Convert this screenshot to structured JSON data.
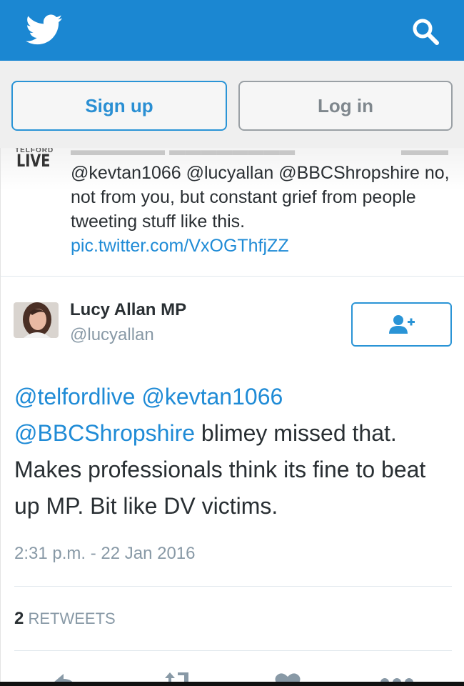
{
  "header": {
    "logo_icon": "twitter-bird-icon",
    "search_icon": "search-icon",
    "brand_color": "#1b87d2"
  },
  "auth": {
    "signup_label": "Sign up",
    "login_label": "Log in"
  },
  "previous_tweet": {
    "avatar_text": "LIVE",
    "text": "@kevtan1066 @lucyallan @BBCShropshire no, not from you, but constant grief from people tweeting stuff like this.",
    "link": "pic.twitter.com/VxOGThfjZZ"
  },
  "tweet": {
    "author_name": "Lucy Allan MP",
    "author_handle": "@lucyallan",
    "follow_icon": "follow-user-icon",
    "mentions_line1": [
      "@telfordlive",
      "@kevtan1066"
    ],
    "mention_line2": "@BBCShropshire",
    "text_after_mentions": " blimey missed that. Makes professionals think its fine to beat up MP. Bit like DV victims.",
    "timestamp": "2:31 p.m. - 22 Jan 2016",
    "retweet_count": "2",
    "retweet_label": "RETWEETS"
  },
  "actions": [
    "reply-icon",
    "retweet-icon",
    "like-icon",
    "more-icon"
  ],
  "colors": {
    "link": "#1f8bd6",
    "muted": "#8899a6",
    "text": "#292f33"
  }
}
